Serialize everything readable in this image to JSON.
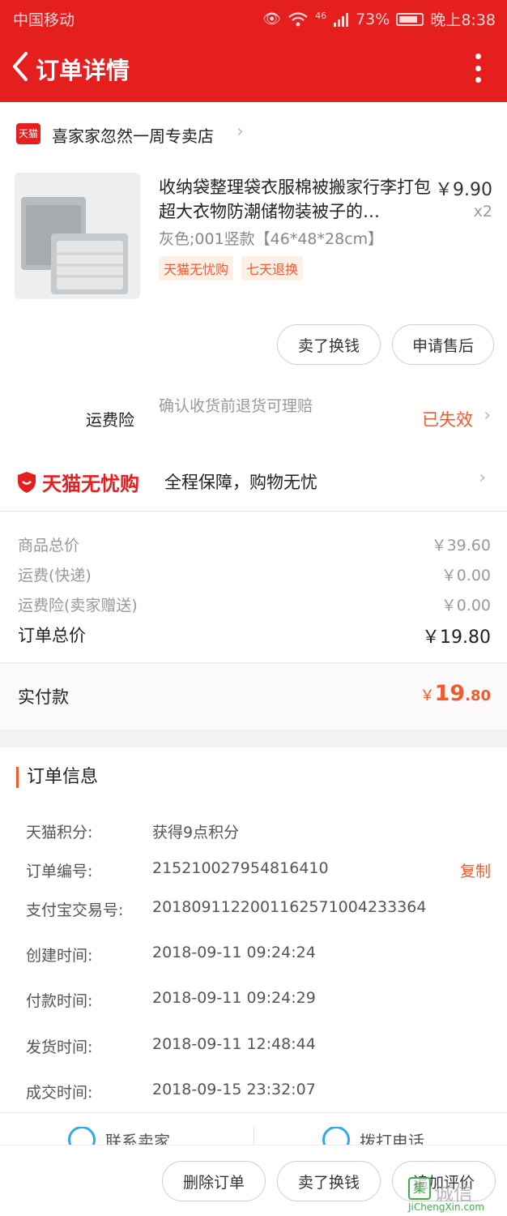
{
  "status_bar": {
    "carrier": "中国移动",
    "network": "46",
    "battery": "73%",
    "time": "晚上8:38"
  },
  "nav": {
    "title": "订单详情"
  },
  "store": {
    "badge": "天猫",
    "name": "喜家家忽然一周专卖店"
  },
  "product": {
    "title": "收纳袋整理袋衣服棉被搬家行李打包超大衣物防潮储物装被子的…",
    "price": "￥9.90",
    "qty": "x2",
    "spec": "灰色;001竖款【46*48*28cm】",
    "tags": [
      "天猫无忧购",
      "七天退换"
    ],
    "buttons": {
      "sell": "卖了换钱",
      "after_sale": "申请售后"
    }
  },
  "insurance": {
    "label": "运费险",
    "desc": "确认收货前退货可理赔",
    "status": "已失效"
  },
  "worry_free": {
    "logo": "天猫无忧购",
    "text": "全程保障，购物无忧"
  },
  "prices": [
    {
      "label": "商品总价",
      "value": "￥39.60"
    },
    {
      "label": "运费(快递)",
      "value": "￥0.00"
    },
    {
      "label": "运费险(卖家赠送)",
      "value": "￥0.00"
    }
  ],
  "order_total": {
    "label": "订单总价",
    "value": "￥19.80"
  },
  "paid": {
    "label": "实付款",
    "currency": "￥",
    "int": "19",
    "dec": ".80"
  },
  "order_info": {
    "title": "订单信息",
    "rows": [
      {
        "label": "天猫积分:",
        "value": "获得9点积分"
      },
      {
        "label": "订单编号:",
        "value": "215210027954816410",
        "action": "复制"
      },
      {
        "label": "支付宝交易号:",
        "value": "2018091122001162571004233364"
      },
      {
        "label": "创建时间:",
        "value": "2018-09-11 09:24:24"
      },
      {
        "label": "付款时间:",
        "value": "2018-09-11 09:24:29"
      },
      {
        "label": "发货时间:",
        "value": "2018-09-11 12:48:44"
      },
      {
        "label": "成交时间:",
        "value": "2018-09-15 23:32:07"
      }
    ]
  },
  "contact": {
    "seller": "联系卖家",
    "call": "拨打电话"
  },
  "actions": {
    "delete": "删除订单",
    "sell": "卖了换钱",
    "review": "追加评价"
  },
  "watermark": {
    "logo": "集",
    "text": "诚信",
    "url": "JiChengXin.com"
  },
  "colors": {
    "brand_red": "#e51e1e",
    "accent_orange": "#f25a2b"
  }
}
